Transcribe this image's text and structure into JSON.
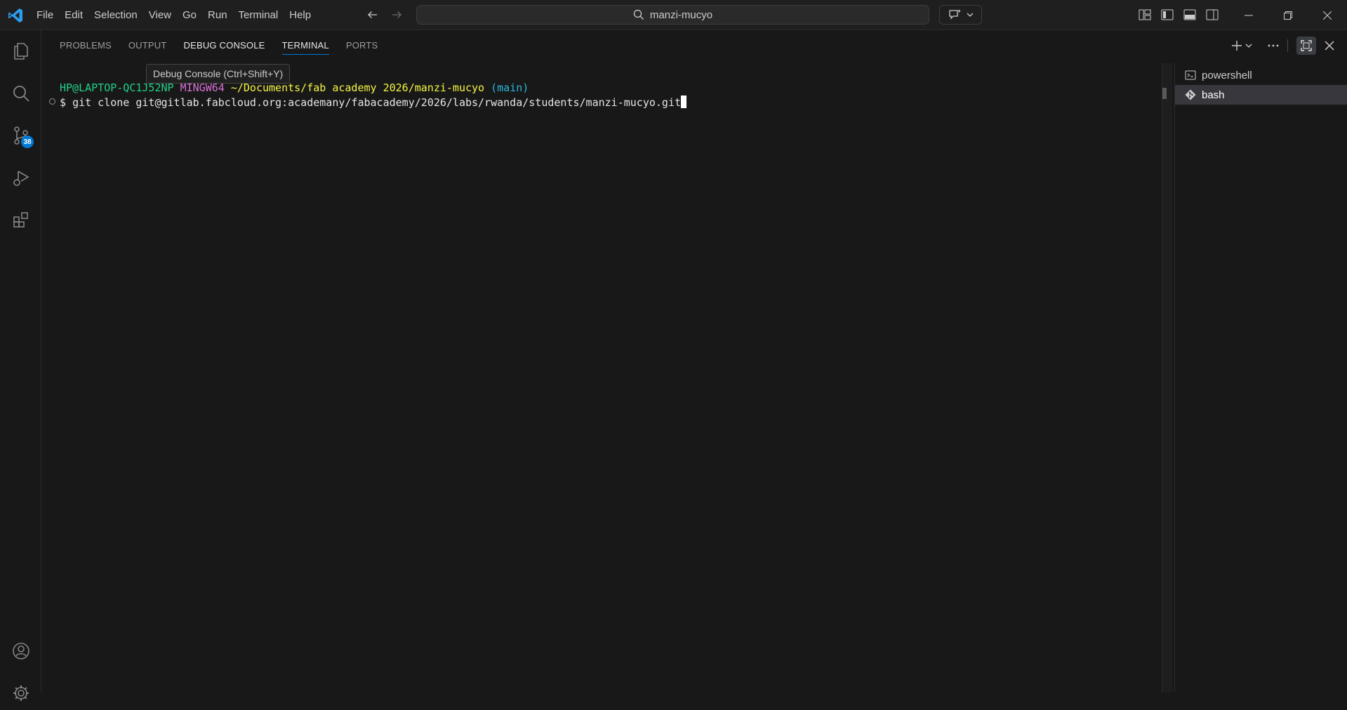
{
  "menu": [
    "File",
    "Edit",
    "Selection",
    "View",
    "Go",
    "Run",
    "Terminal",
    "Help"
  ],
  "search": {
    "text": "manzi-mucyo"
  },
  "activity_bar": {
    "items": [
      "explorer-icon",
      "search-icon",
      "source-control-icon",
      "run-debug-icon",
      "extensions-icon"
    ],
    "source_control_badge": "38",
    "bottom": [
      "accounts-icon",
      "settings-gear-icon"
    ]
  },
  "panel": {
    "tabs": [
      "PROBLEMS",
      "OUTPUT",
      "DEBUG CONSOLE",
      "TERMINAL",
      "PORTS"
    ],
    "active_tab": "TERMINAL",
    "tooltip": "Debug Console (Ctrl+Shift+Y)"
  },
  "terminal": {
    "prompt_user": "HP@LAPTOP-QC1J52NP",
    "prompt_env": "MINGW64",
    "prompt_path": "~/Documents/fab academy 2026/manzi-mucyo",
    "prompt_branch": "(main)",
    "prompt_symbol": "$",
    "command": "git clone git@gitlab.fabcloud.org:academany/fabacademy/2026/labs/rwanda/students/manzi-mucyo.git"
  },
  "terminal_list": [
    {
      "label": "powershell",
      "icon": "terminal-icon"
    },
    {
      "label": "bash",
      "icon": "git-icon",
      "selected": true
    }
  ],
  "colors": {
    "accent": "#0078d4",
    "prompt_green": "#23d18b",
    "prompt_magenta": "#d670d6",
    "prompt_yellow": "#f5f543",
    "prompt_cyan": "#29b8db"
  }
}
